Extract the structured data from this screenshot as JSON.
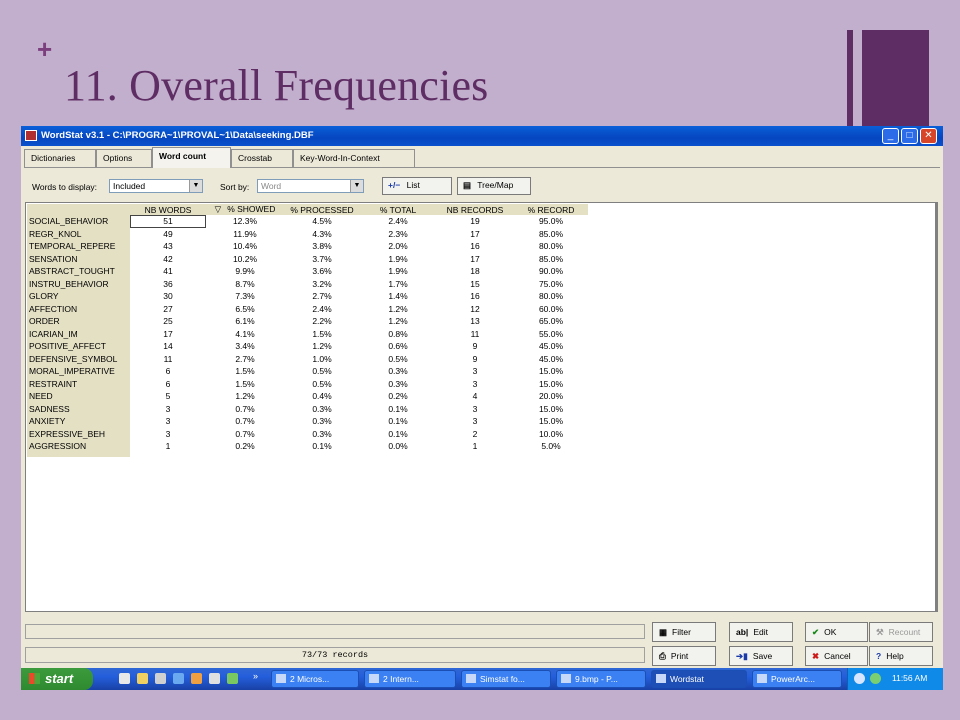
{
  "slide": {
    "plus": "+",
    "title": "11. Overall Frequencies"
  },
  "window": {
    "title": "WordStat v3.1 - C:\\PROGRA~1\\PROVAL~1\\Data\\seeking.DBF",
    "controls": {
      "minimize": "_",
      "maximize": "□",
      "close": "✕"
    }
  },
  "tabs": [
    "Dictionaries",
    "Options",
    "Word count",
    "Crosstab",
    "Key-Word-In-Context"
  ],
  "active_tab": "Word count",
  "toolbar": {
    "words_label": "Words to display:",
    "words_value": "Included",
    "sort_label": "Sort by:",
    "sort_value": "Word",
    "list_button": "List",
    "treemap_button": "Tree/Map"
  },
  "grid": {
    "columns": [
      "NB WORDS",
      "% SHOWED",
      "% PROCESSED",
      "% TOTAL",
      "NB RECORDS",
      "% RECORD"
    ],
    "sort_indicator": "▽",
    "rows": [
      [
        "SOCIAL_BEHAVIOR",
        "51",
        "12.3%",
        "4.5%",
        "2.4%",
        "19",
        "95.0%"
      ],
      [
        "REGR_KNOL",
        "49",
        "11.9%",
        "4.3%",
        "2.3%",
        "17",
        "85.0%"
      ],
      [
        "TEMPORAL_REPERE",
        "43",
        "10.4%",
        "3.8%",
        "2.0%",
        "16",
        "80.0%"
      ],
      [
        "SENSATION",
        "42",
        "10.2%",
        "3.7%",
        "1.9%",
        "17",
        "85.0%"
      ],
      [
        "ABSTRACT_TOUGHT",
        "41",
        "9.9%",
        "3.6%",
        "1.9%",
        "18",
        "90.0%"
      ],
      [
        "INSTRU_BEHAVIOR",
        "36",
        "8.7%",
        "3.2%",
        "1.7%",
        "15",
        "75.0%"
      ],
      [
        "GLORY",
        "30",
        "7.3%",
        "2.7%",
        "1.4%",
        "16",
        "80.0%"
      ],
      [
        "AFFECTION",
        "27",
        "6.5%",
        "2.4%",
        "1.2%",
        "12",
        "60.0%"
      ],
      [
        "ORDER",
        "25",
        "6.1%",
        "2.2%",
        "1.2%",
        "13",
        "65.0%"
      ],
      [
        "ICARIAN_IM",
        "17",
        "4.1%",
        "1.5%",
        "0.8%",
        "11",
        "55.0%"
      ],
      [
        "POSITIVE_AFFECT",
        "14",
        "3.4%",
        "1.2%",
        "0.6%",
        "9",
        "45.0%"
      ],
      [
        "DEFENSIVE_SYMBOL",
        "11",
        "2.7%",
        "1.0%",
        "0.5%",
        "9",
        "45.0%"
      ],
      [
        "MORAL_IMPERATIVE",
        "6",
        "1.5%",
        "0.5%",
        "0.3%",
        "3",
        "15.0%"
      ],
      [
        "RESTRAINT",
        "6",
        "1.5%",
        "0.5%",
        "0.3%",
        "3",
        "15.0%"
      ],
      [
        "NEED",
        "5",
        "1.2%",
        "0.4%",
        "0.2%",
        "4",
        "20.0%"
      ],
      [
        "SADNESS",
        "3",
        "0.7%",
        "0.3%",
        "0.1%",
        "3",
        "15.0%"
      ],
      [
        "ANXIETY",
        "3",
        "0.7%",
        "0.3%",
        "0.1%",
        "3",
        "15.0%"
      ],
      [
        "EXPRESSIVE_BEH",
        "3",
        "0.7%",
        "0.3%",
        "0.1%",
        "2",
        "10.0%"
      ],
      [
        "AGGRESSION",
        "1",
        "0.2%",
        "0.1%",
        "0.0%",
        "1",
        "5.0%"
      ]
    ]
  },
  "status": {
    "records": "73/73 records"
  },
  "buttons": {
    "filter": "Filter",
    "edit": "Edit",
    "ok": "OK",
    "recount": "Recount",
    "print": "Print",
    "save": "Save",
    "cancel": "Cancel",
    "help": "Help"
  },
  "taskbar": {
    "start": "start",
    "chevron": "»",
    "tasks": [
      "2 Micros...",
      "2 Intern...",
      "Simstat fo...",
      "9.bmp - P...",
      "Wordstat",
      "PowerArc..."
    ],
    "active_task": "Wordstat",
    "clock": "11:56 AM"
  },
  "colors": {
    "slide_bg": "#c2aecd",
    "title": "#5e2d63",
    "titlebar": "#0546c0",
    "grid_header": "#e4e0c4"
  }
}
